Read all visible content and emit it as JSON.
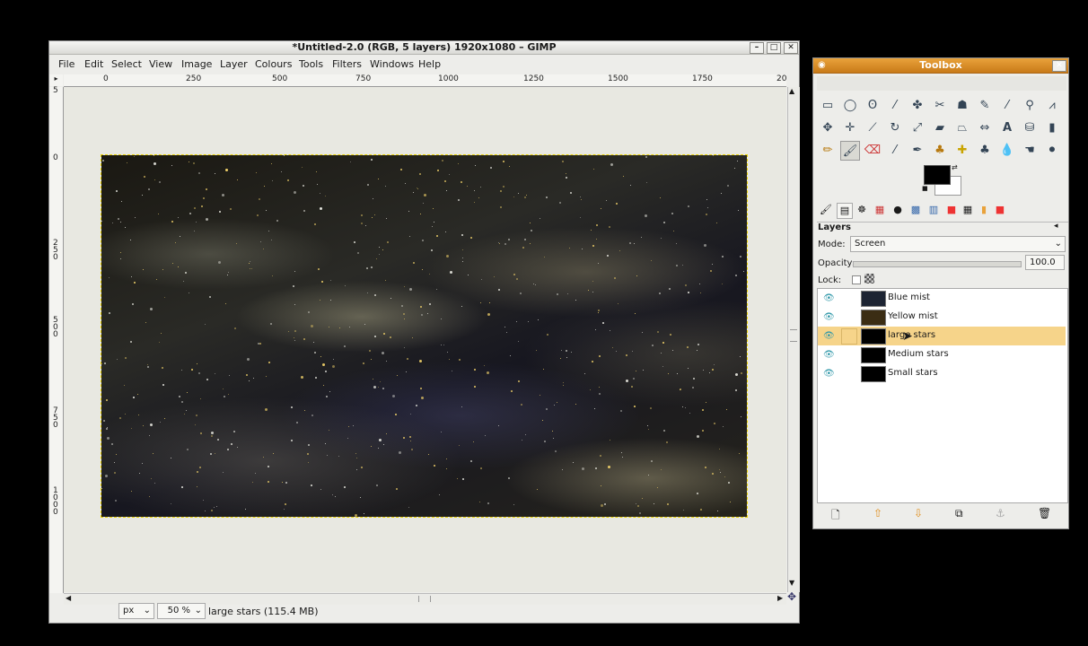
{
  "image_window": {
    "title": "*Untitled-2.0 (RGB, 5 layers) 1920x1080 – GIMP",
    "menu": [
      "File",
      "Edit",
      "Select",
      "View",
      "Image",
      "Layer",
      "Colours",
      "Tools",
      "Filters",
      "Windows",
      "Help"
    ],
    "ruler_top": [
      "0",
      "250",
      "500",
      "750",
      "1000",
      "1250",
      "1500",
      "1750",
      "20"
    ],
    "ruler_left": [
      "5",
      "0",
      "2\n5\n0",
      "5\n0\n0",
      "7\n5\n0",
      "1\n0\n0\n0"
    ],
    "unit": "px",
    "zoom": "50 %",
    "status": "large stars (115.4 MB)"
  },
  "toolbox": {
    "title": "Toolbox",
    "panel_title": "Layers",
    "mode_label": "Mode:",
    "mode_value": "Screen",
    "opacity_label": "Opacity:",
    "opacity_value": "100.0",
    "lock_label": "Lock:",
    "layers": [
      {
        "name": "Blue mist",
        "visible": true,
        "selected": false
      },
      {
        "name": "Yellow mist",
        "visible": true,
        "selected": false
      },
      {
        "name": "large stars",
        "visible": true,
        "selected": true
      },
      {
        "name": "Medium stars",
        "visible": true,
        "selected": false
      },
      {
        "name": "Small stars",
        "visible": true,
        "selected": false
      }
    ]
  },
  "colors": {
    "selection": "#f6d48a",
    "toolbox_title": "#e09530",
    "fg": "#000000",
    "bg": "#ffffff"
  },
  "icons": [
    "minimize-icon",
    "maximize-icon",
    "close-icon",
    "eye-icon",
    "new-layer-icon",
    "raise-layer-icon",
    "lower-layer-icon",
    "duplicate-layer-icon",
    "anchor-layer-icon",
    "delete-layer-icon"
  ]
}
